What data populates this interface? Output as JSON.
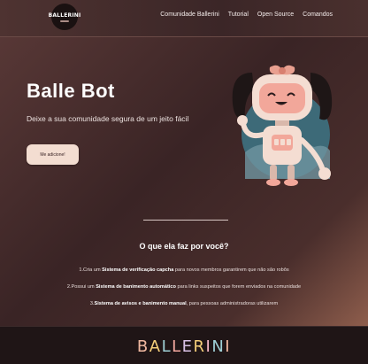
{
  "navbar": {
    "logo_text": "BALLERINI",
    "links": [
      "Comunidade Ballerini",
      "Tutorial",
      "Open Source",
      "Comandos"
    ]
  },
  "hero": {
    "title": "Balle Bot",
    "subtitle": "Deixe a sua comunidade segura de um jeito fácil",
    "add_button": "Me adicione!"
  },
  "features": {
    "title": "O que ela faz por você?",
    "items": [
      {
        "pre": "1.Cria um ",
        "bold": "Sistema de verificação capcha",
        "post": " para novos membros garantirem que não são robôs"
      },
      {
        "pre": "2.Possui um ",
        "bold": "Sistema de banimento automático",
        "post": " para links suspeitos que forem enviados na comunidade"
      },
      {
        "pre": "3.",
        "bold": "Sistema de avisos e banimento manual",
        "post": ", para pessoas administradoras utilizarem"
      }
    ]
  },
  "footer": {
    "brand_letters": [
      "B",
      "A",
      "L",
      "L",
      "E",
      "R",
      "I",
      "N",
      "I"
    ],
    "brand_colors": [
      "#f0b8a0",
      "#f6d07a",
      "#9fd0d6",
      "#f4a9a0",
      "#d9c2e6",
      "#f6d07a",
      "#f7b9c8",
      "#9fd0d6",
      "#f0b8a0"
    ]
  },
  "colors": {
    "accent": "#f3ddd1",
    "hair": "#1e1616",
    "bow": "#e9a090",
    "robot_body": "#f4ddd2",
    "robot_face": "#f2a79a"
  }
}
